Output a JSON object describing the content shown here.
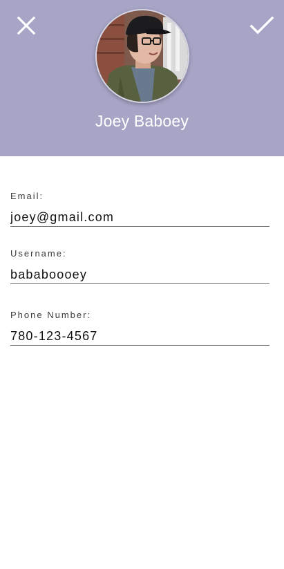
{
  "header": {
    "background_color": "#a7a5c6",
    "close_icon": "close-icon",
    "confirm_icon": "check-icon",
    "profile_name": "Joey Baboey"
  },
  "form": {
    "email": {
      "label": "Email:",
      "value": "joey@gmail.com"
    },
    "username": {
      "label": "Username:",
      "value": "bababoooey"
    },
    "phone": {
      "label": "Phone Number:",
      "value": "780-123-4567"
    }
  }
}
